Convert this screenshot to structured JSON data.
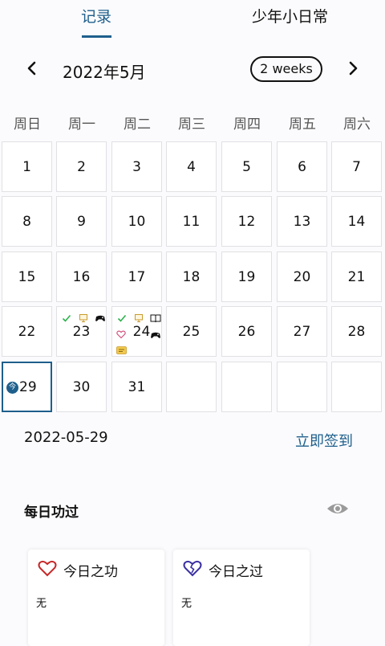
{
  "tabs": [
    {
      "label": "记录",
      "active": true
    },
    {
      "label": "少年小日常",
      "active": false
    }
  ],
  "calendar": {
    "month_title": "2022年5月",
    "view_mode": "2 weeks",
    "weekdays": [
      "周日",
      "周一",
      "周二",
      "周三",
      "周四",
      "周五",
      "周六"
    ],
    "rows": [
      [
        "1",
        "2",
        "3",
        "4",
        "5",
        "6",
        "7"
      ],
      [
        "8",
        "9",
        "10",
        "11",
        "12",
        "13",
        "14"
      ],
      [
        "15",
        "16",
        "17",
        "18",
        "19",
        "20",
        "21"
      ],
      [
        "22",
        "23",
        "24",
        "25",
        "26",
        "27",
        "28"
      ],
      [
        "29",
        "30",
        "31",
        "",
        "",
        "",
        ""
      ]
    ],
    "today_badge": "今",
    "today_day": "29",
    "accent_color": "#1e5f8c"
  },
  "selected_date": "2022-05-29",
  "checkin_label": "立即签到",
  "section": {
    "title": "每日功过",
    "eye_icon": "eye-icon"
  },
  "cards": [
    {
      "title": "今日之功",
      "value": "无",
      "heart_color": "#c62828"
    },
    {
      "title": "今日之过",
      "value": "无",
      "heart_color": "#3a2fa3"
    }
  ]
}
